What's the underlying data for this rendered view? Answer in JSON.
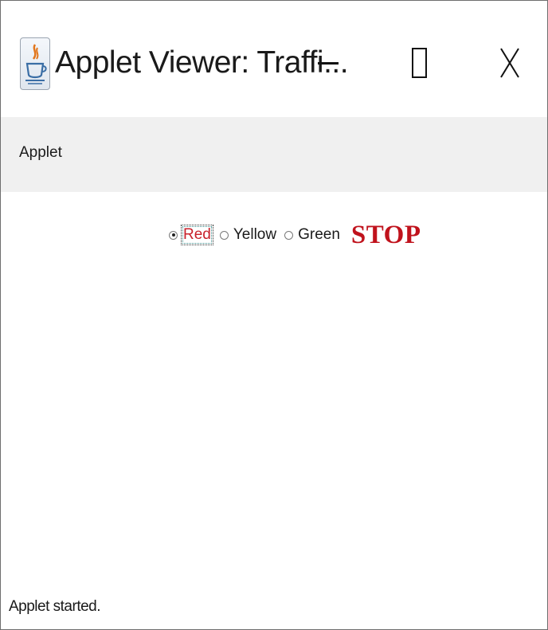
{
  "window": {
    "title": "Applet Viewer: Traffi..."
  },
  "title_bar": {
    "app_icon": "java-coffee-cup-icon",
    "minimize_icon": "minimize-icon",
    "maximize_icon": "maximize-icon",
    "close_icon": "close-icon",
    "close_glyph": "X"
  },
  "menu": {
    "items": [
      {
        "label": "Applet"
      }
    ]
  },
  "applet": {
    "radio_group": [
      {
        "label": "Red",
        "selected": true,
        "focused": true
      },
      {
        "label": "Yellow",
        "selected": false,
        "focused": false
      },
      {
        "label": "Green",
        "selected": false,
        "focused": false
      }
    ],
    "signal_text": "STOP",
    "colors": {
      "signal": "#c0121c",
      "selected_label": "#c8202a"
    }
  },
  "status": {
    "text": "Applet started."
  }
}
